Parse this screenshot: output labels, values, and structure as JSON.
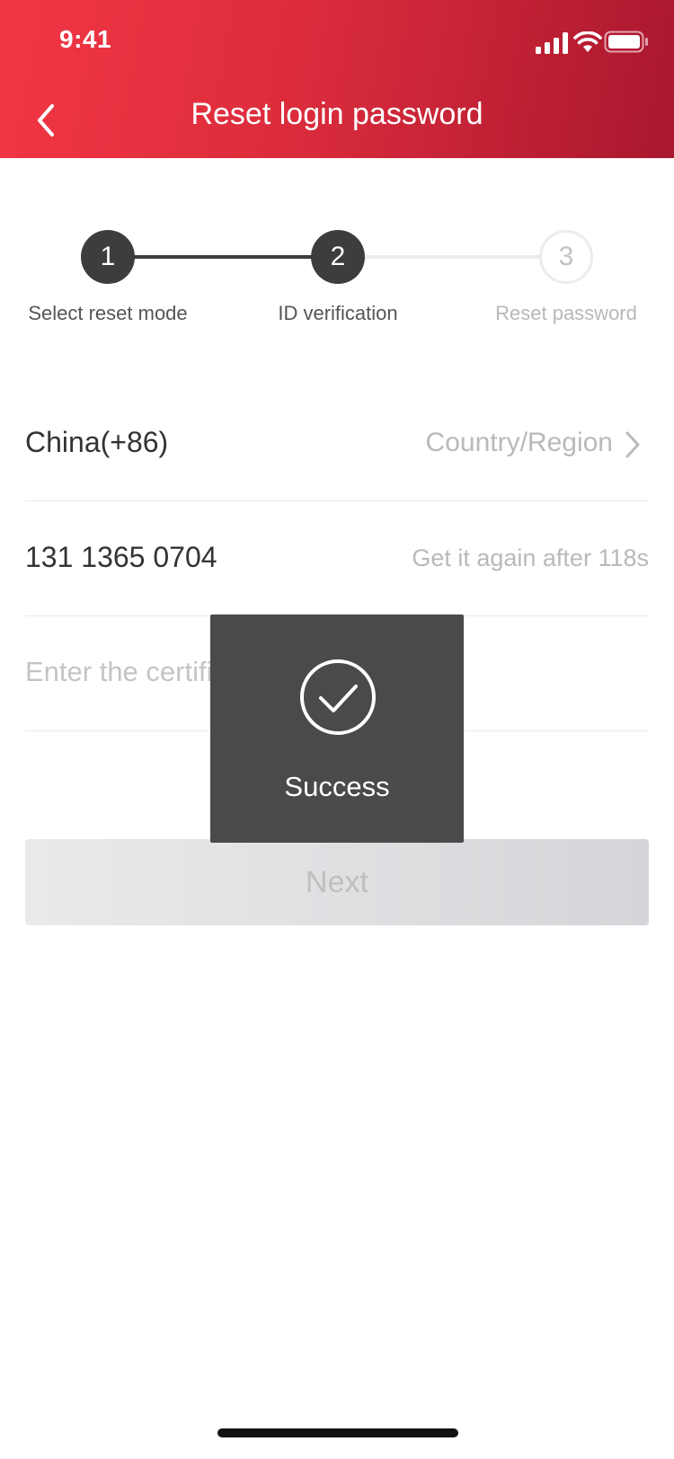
{
  "status_bar": {
    "time": "9:41"
  },
  "nav": {
    "title": "Reset login password"
  },
  "steps": [
    {
      "number": "1",
      "label": "Select reset mode",
      "state": "done"
    },
    {
      "number": "2",
      "label": "ID verification",
      "state": "done"
    },
    {
      "number": "3",
      "label": "Reset password",
      "state": "todo"
    }
  ],
  "form": {
    "country_value": "China(+86)",
    "country_label": "Country/Region",
    "phone_value": "131 1365 0704",
    "resend_text": "Get it again after 118s",
    "code_placeholder": "Enter the certification code"
  },
  "buttons": {
    "next_label": "Next"
  },
  "toast": {
    "text": "Success"
  },
  "colors": {
    "header_start": "#f23644",
    "header_end": "#a9172f",
    "step_active": "#3d3d3d",
    "toast_bg": "#4a4a4a"
  },
  "icons": [
    "back-icon",
    "signal-icon",
    "wifi-icon",
    "battery-icon",
    "chevron-right-icon",
    "check-circle-icon"
  ]
}
